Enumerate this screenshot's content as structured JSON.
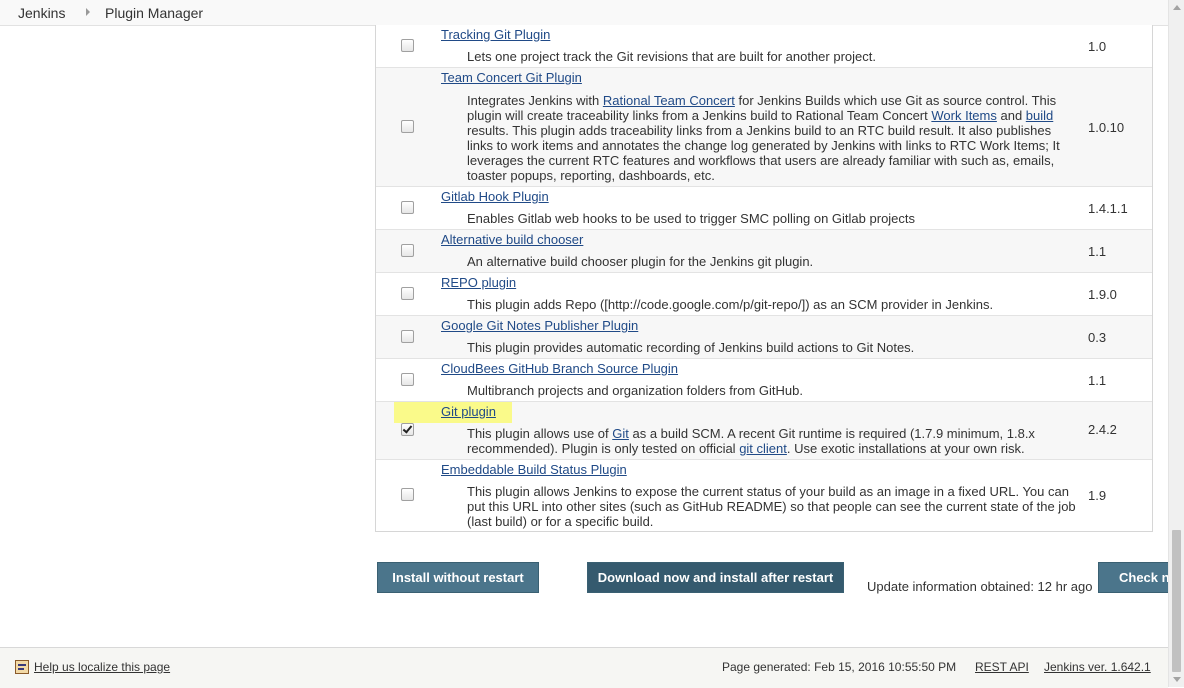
{
  "breadcrumb": {
    "items": [
      "Jenkins",
      "Plugin Manager"
    ]
  },
  "plugins": [
    {
      "name": "Tracking Git Plugin",
      "desc_parts": [
        "Lets one project track the Git revisions that are built for another project."
      ],
      "version": "1.0",
      "checked": false
    },
    {
      "name": "Team Concert Git Plugin",
      "desc_parts": [
        "Integrates Jenkins with ",
        "Rational Team Concert",
        " for Jenkins Builds which use Git as source control. This plugin will create traceability links from a Jenkins build to Rational Team Concert ",
        "Work Items",
        " and ",
        "build",
        " results. This plugin adds traceability links from a Jenkins build to an RTC build result.  It also publishes links to work items and annotates the change log generated by Jenkins with links to RTC Work Items; It leverages the current RTC features and workflows that users are already familiar with such as, emails, toaster popups, reporting, dashboards, etc."
      ],
      "version": "1.0.10",
      "checked": false
    },
    {
      "name": "Gitlab Hook Plugin",
      "desc_parts": [
        "Enables Gitlab web hooks to be used to trigger SMC polling on Gitlab projects"
      ],
      "version": "1.4.1.1",
      "checked": false
    },
    {
      "name": "Alternative build chooser",
      "desc_parts": [
        "An alternative build chooser plugin for the Jenkins git plugin."
      ],
      "version": "1.1",
      "checked": false
    },
    {
      "name": "REPO plugin",
      "desc_parts": [
        "This plugin adds Repo ([http://code.google.com/p/git-repo/]) as an SCM provider in Jenkins."
      ],
      "version": "1.9.0",
      "checked": false
    },
    {
      "name": "Google Git Notes Publisher Plugin",
      "desc_parts": [
        "This plugin provides automatic recording of Jenkins build actions to Git Notes."
      ],
      "version": "0.3",
      "checked": false
    },
    {
      "name": "CloudBees GitHub Branch Source Plugin",
      "desc_parts": [
        "Multibranch projects and organization folders from GitHub."
      ],
      "version": "1.1",
      "checked": false
    },
    {
      "name": "Git plugin",
      "desc_parts": [
        "This plugin allows use of ",
        "Git",
        " as a build SCM. A recent Git runtime is required (1.7.9 minimum, 1.8.x recommended). Plugin is only tested on official ",
        "git client",
        ". Use exotic installations at your own risk."
      ],
      "version": "2.4.2",
      "checked": true,
      "highlighted": true
    },
    {
      "name": "Embeddable Build Status Plugin",
      "desc_parts": [
        "This plugin allows Jenkins to expose the current status of your build as an image in a fixed URL. You can put this URL into other sites (such as GitHub README) so that people can see the current state of the job (last build) or for a specific build."
      ],
      "version": "1.9",
      "checked": false
    }
  ],
  "actions": {
    "install_without_restart": "Install without restart",
    "download_and_install": "Download now and install after restart",
    "update_info_label": "Update information obtained: 12 hr ago",
    "check_now": "Check now"
  },
  "footer": {
    "localize_link": "Help us localize this page",
    "page_generated": "Page generated: Feb 15, 2016 10:55:50 PM",
    "rest_api": "REST API",
    "jenkins_version": "Jenkins ver. 1.642.1"
  },
  "colors": {
    "button_bg": "#4b758b",
    "link": "#204a87",
    "highlight": "#fafa8a"
  }
}
